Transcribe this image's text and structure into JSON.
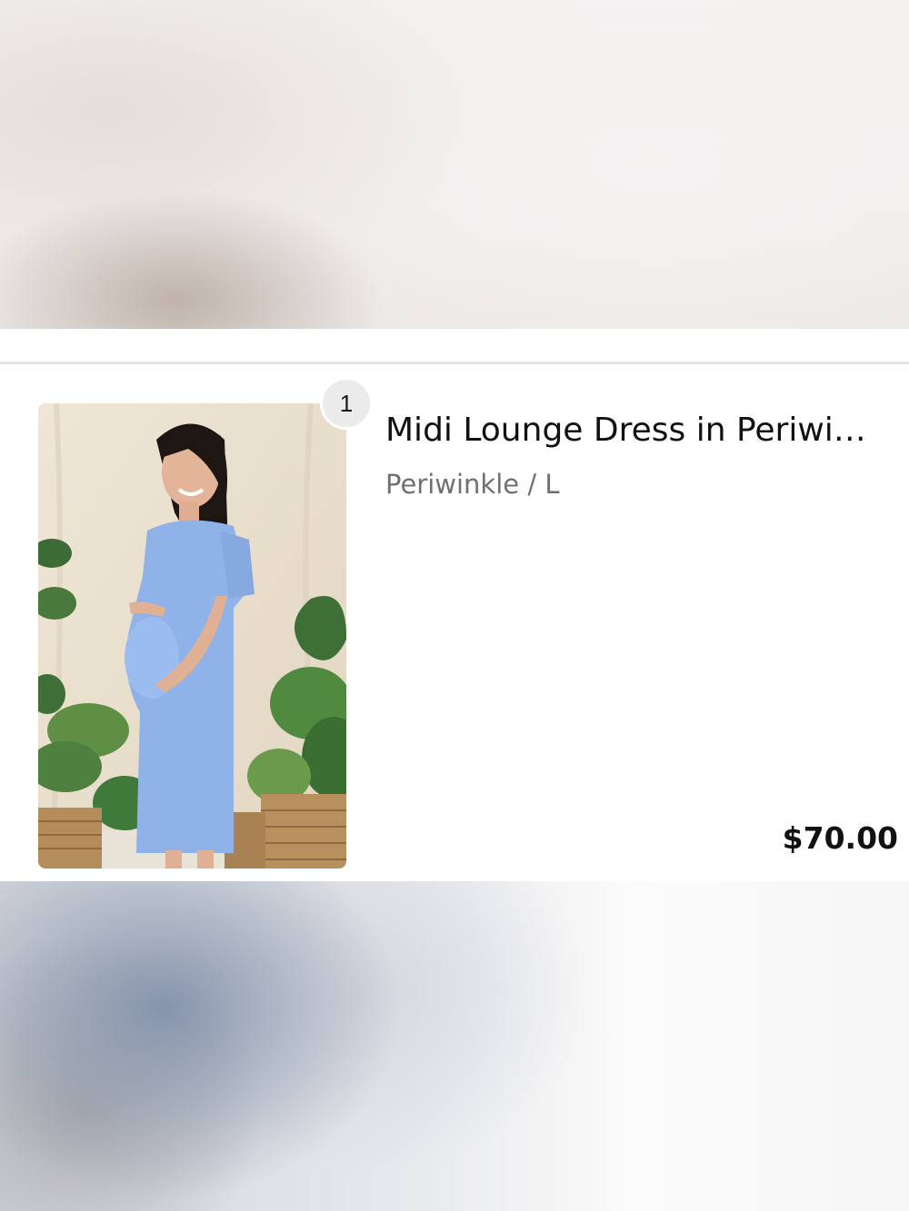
{
  "cart_item": {
    "quantity": "1",
    "title": "Midi Lounge Dress in Periwi…",
    "variant": "Periwinkle / L",
    "price": "$70.00"
  },
  "colors": {
    "dress": "#8fb2e8",
    "backdrop": "#ece3d4",
    "badge": "#ebebeb",
    "divider": "#e4e4e6"
  }
}
